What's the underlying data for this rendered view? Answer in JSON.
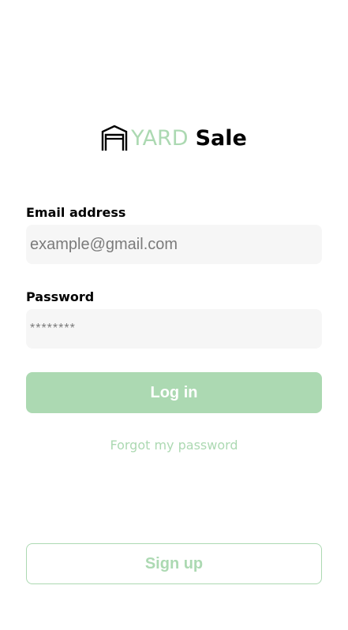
{
  "logo": {
    "icon": "garage-icon",
    "word_yard": "YARD",
    "word_sale": "Sale",
    "accent_color": "#acd9b2"
  },
  "form": {
    "email_label": "Email address",
    "email_placeholder": "example@gmail.com",
    "password_label": "Password",
    "password_placeholder": "********",
    "login_label": "Log in",
    "forgot_label": "Forgot my password"
  },
  "signup": {
    "label": "Sign up"
  }
}
